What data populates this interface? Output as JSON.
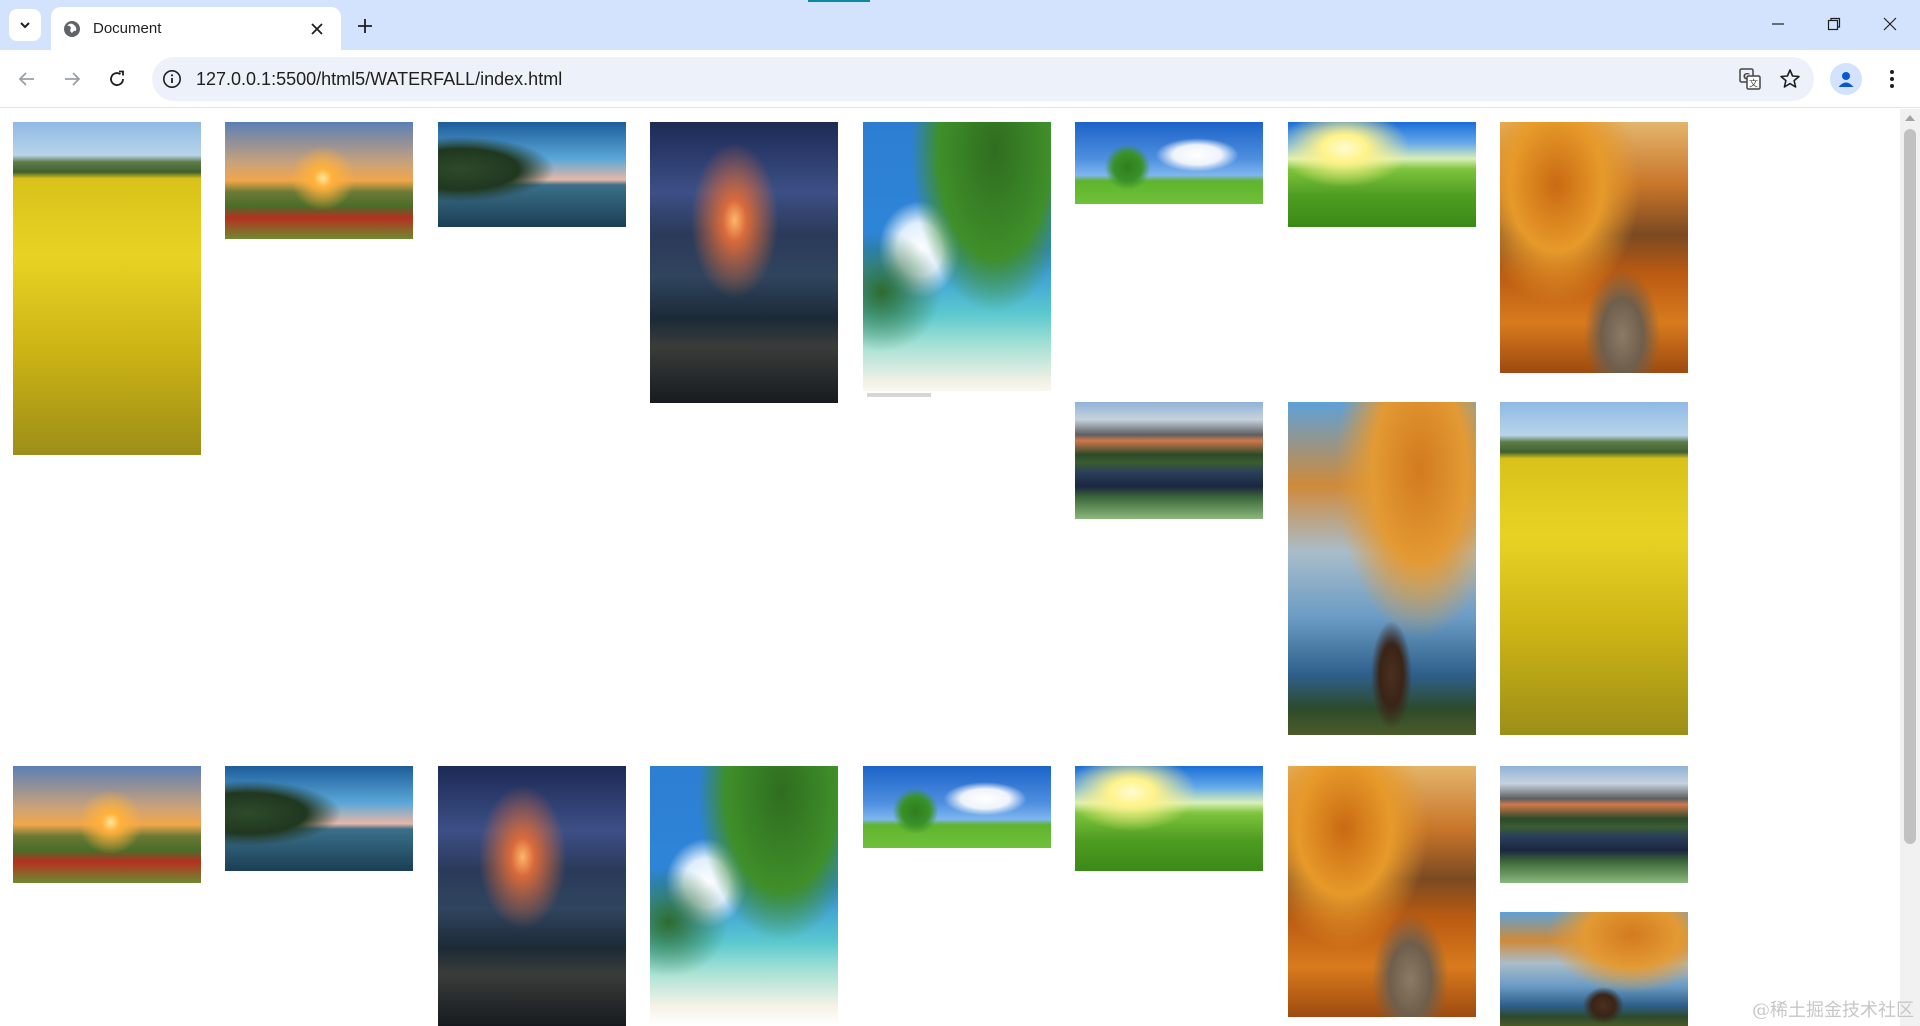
{
  "browser": {
    "tab": {
      "title": "Document",
      "favicon": "globe-icon"
    },
    "window_controls": [
      "minimize-icon",
      "restore-icon",
      "close-icon"
    ],
    "address_bar": {
      "url": "127.0.0.1:5500/html5/WATERFALL/index.html"
    },
    "toolbar_icons": [
      "back-icon",
      "forward-icon",
      "reload-icon",
      "site-info-icon",
      "translate-icon",
      "bookmark-star-icon",
      "profile-icon",
      "menu-icon"
    ],
    "accent_color": "#d3e3fd"
  },
  "page": {
    "layout": "waterfall",
    "columns": 8,
    "photos": [
      {
        "column": 1,
        "scene": "rapeseed field"
      },
      {
        "column": 2,
        "scene": "sunset poppy field"
      },
      {
        "column": 3,
        "scene": "lake with cliff"
      },
      {
        "column": 4,
        "scene": "volcano over rocky shore"
      },
      {
        "column": 5,
        "scene": "leaves over tropical beach"
      },
      {
        "column": 6,
        "scene": "tree under clouds"
      },
      {
        "column": 7,
        "scene": "green meadow"
      },
      {
        "column": 8,
        "scene": "autumn path"
      },
      {
        "column": 6,
        "scene": "mountain lake reflection"
      },
      {
        "column": 7,
        "scene": "autumn tree with bench"
      },
      {
        "column": 8,
        "scene": "rapeseed field"
      },
      {
        "column": 1,
        "scene": "sunset poppy field"
      },
      {
        "column": 2,
        "scene": "lake with cliff"
      },
      {
        "column": 3,
        "scene": "volcano over rocky shore"
      },
      {
        "column": 4,
        "scene": "leaves over tropical beach"
      },
      {
        "column": 5,
        "scene": "tree under clouds"
      },
      {
        "column": 6,
        "scene": "green meadow"
      },
      {
        "column": 7,
        "scene": "autumn path"
      },
      {
        "column": 8,
        "scene": "mountain lake reflection"
      },
      {
        "column": 8,
        "scene": "autumn tree with bench"
      }
    ]
  },
  "watermark": {
    "text": "@稀土掘金技术社区"
  }
}
